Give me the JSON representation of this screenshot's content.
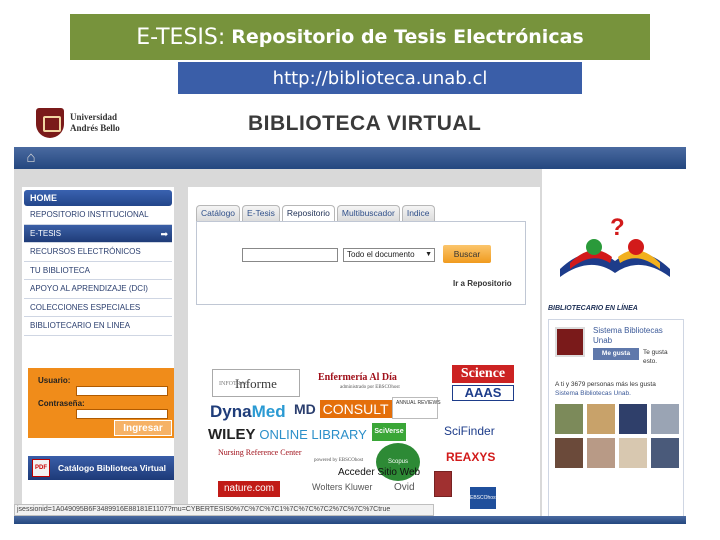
{
  "slide": {
    "title_prefix": "E-TESIS:",
    "title_rest": "Repositorio de Tesis Electrónicas",
    "url": "http://biblioteca.unab.cl"
  },
  "header": {
    "logo_line1": "Universidad",
    "logo_line2": "Andrés Bello",
    "title": "BIBLIOTECA VIRTUAL"
  },
  "sidebar": {
    "items": [
      {
        "label": "HOME"
      },
      {
        "label": "REPOSITORIO INSTITUCIONAL"
      },
      {
        "label": "E-TESIS",
        "arrow": "➡"
      },
      {
        "label": "RECURSOS ELECTRÓNICOS"
      },
      {
        "label": "TU BIBLIOTECA"
      },
      {
        "label": "APOYO AL APRENDIZAJE (DCI)"
      },
      {
        "label": "COLECCIONES ESPECIALES"
      },
      {
        "label": "BIBLIOTECARIO EN LINEA"
      }
    ]
  },
  "login": {
    "user_label": "Usuario:",
    "password_label": "Contraseña:",
    "submit_label": "Ingresar"
  },
  "catalog_button": {
    "label": "Catálogo Biblioteca Virtual",
    "icon_text": "PDF"
  },
  "tabs": [
    {
      "label": "Catálogo"
    },
    {
      "label": "E-Tesis"
    },
    {
      "label": "Repositorio"
    },
    {
      "label": "Multibuscador"
    },
    {
      "label": "Indice"
    }
  ],
  "search": {
    "select_value": "Todo el documento",
    "button_label": "Buscar",
    "repo_link": "Ir a Repositorio"
  },
  "resources": {
    "informe_small": "INFOTRAC",
    "informe": "Informe",
    "enfermeria": "Enfermería Al Día",
    "enfermeria_sub": "administrado por EBSCOhost",
    "science": "Science",
    "aaas": "AAAS",
    "dyna_a": "Dyna",
    "dyna_b": "Med",
    "md_a": "MD",
    "md_b": "CONSULT",
    "annual": "ANNUAL REVIEWS",
    "wiley_a": "WILEY",
    "wiley_b": "ONLINE LIBRARY",
    "sciverse": "SciVerse",
    "scopus": "Scopus",
    "scifinder": "SciFinder",
    "reaxys": "REAXYS",
    "nrc": "Nursing Reference Center",
    "nrc_sub": "powered by EBSCOhost",
    "nature": "nature.com",
    "wk": "Wolters Kluwer",
    "ovid": "Ovid",
    "ebsco": "EBSCOhost",
    "acceder": "Acceder Sitio Web"
  },
  "right": {
    "bibliotecario": "BIBLIOTECARIO EN LÍNEA",
    "fb_name": "Sistema Bibliotecas Unab",
    "fb_like": "Me gusta",
    "fb_gusta": "Te gusta esto.",
    "fb_count_a": "A ti y 3679 personas más les gusta",
    "fb_count_b": "Sistema Bibliotecas Unab.",
    "fans": [
      "",
      "",
      "",
      "",
      "",
      "",
      "",
      ""
    ]
  },
  "status_bar": "jsessionid=1A049095B6F3489916E88181E1107?rnu=CYBERTESIS0%7C%7C%7C1%7C%7C%7C2%7C%7C%7Ctrue",
  "colors": {
    "title_bg": "#77933c",
    "url_bg": "#3a5ea8",
    "nav_blue": "#24477f",
    "orange": "#f08c1a"
  }
}
